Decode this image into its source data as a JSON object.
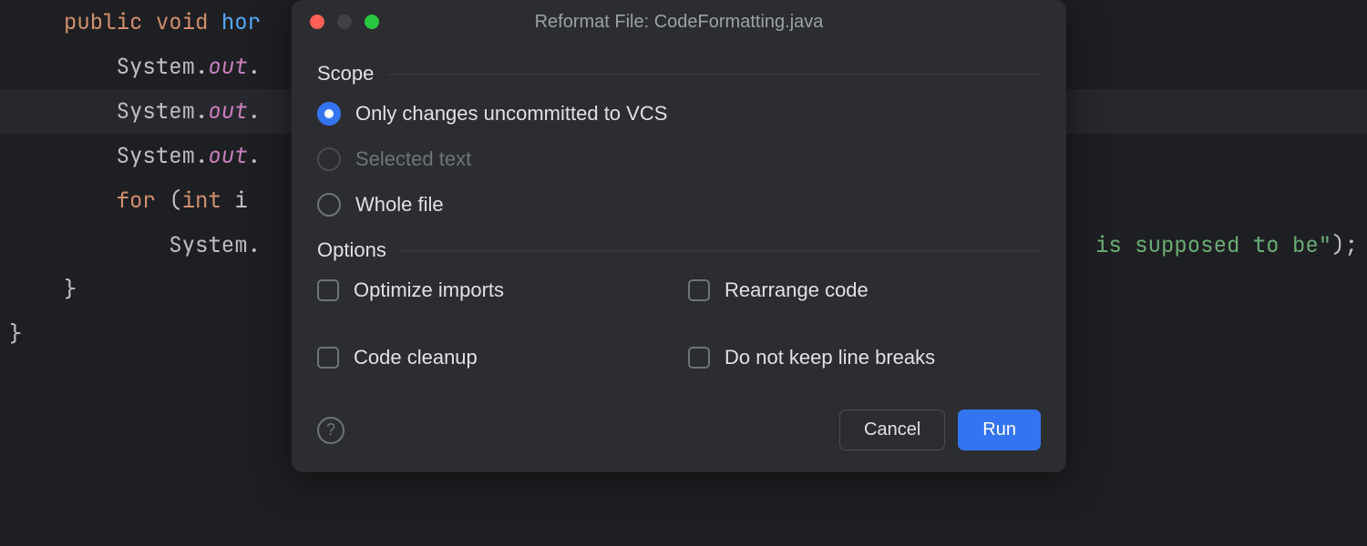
{
  "editor": {
    "lines": [
      {
        "hl": false,
        "segs": [
          {
            "t": "public ",
            "c": "kw-public"
          },
          {
            "t": "void ",
            "c": "kw-void"
          },
          {
            "t": "hor",
            "c": "method"
          }
        ]
      },
      {
        "hl": false,
        "indent": "    ",
        "segs": [
          {
            "t": "System.",
            "c": "ident"
          },
          {
            "t": "out",
            "c": "field-it"
          },
          {
            "t": ".",
            "c": "pn"
          }
        ]
      },
      {
        "hl": true,
        "indent": "    ",
        "segs": [
          {
            "t": "System.",
            "c": "ident"
          },
          {
            "t": "out",
            "c": "field-it"
          },
          {
            "t": ".",
            "c": "pn"
          }
        ]
      },
      {
        "hl": false,
        "indent": "    ",
        "segs": [
          {
            "t": "System.",
            "c": "ident"
          },
          {
            "t": "out",
            "c": "field-it"
          },
          {
            "t": ".",
            "c": "pn"
          }
        ]
      },
      {
        "hl": false,
        "indent": "    ",
        "segs": [
          {
            "t": "for ",
            "c": "kw-for"
          },
          {
            "t": "(",
            "c": "pn"
          },
          {
            "t": "int ",
            "c": "kw-int"
          },
          {
            "t": "i",
            "c": "ident"
          }
        ]
      },
      {
        "hl": false,
        "indent": "        ",
        "segs": [
          {
            "t": "System.",
            "c": "ident"
          }
        ],
        "tail": [
          {
            "t": "is supposed to be\"",
            "c": "str"
          },
          {
            "t": ");",
            "c": "pn"
          }
        ]
      },
      {
        "hl": false,
        "indent": "",
        "segs": [
          {
            "t": "}",
            "c": "pn"
          }
        ]
      },
      {
        "hl": false,
        "indent": "",
        "segs": []
      },
      {
        "hl": false,
        "noindent": true,
        "segs": [
          {
            "t": "}",
            "c": "pn"
          }
        ]
      }
    ]
  },
  "dialog": {
    "title": "Reformat File: CodeFormatting.java",
    "scope": {
      "heading": "Scope",
      "options": [
        {
          "label": "Only changes uncommitted to VCS",
          "selected": true,
          "disabled": false
        },
        {
          "label": "Selected text",
          "selected": false,
          "disabled": true
        },
        {
          "label": "Whole file",
          "selected": false,
          "disabled": false
        }
      ]
    },
    "options": {
      "heading": "Options",
      "items": [
        {
          "label": "Optimize imports",
          "checked": false
        },
        {
          "label": "Rearrange code",
          "checked": false
        },
        {
          "label": "Code cleanup",
          "checked": false
        },
        {
          "label": "Do not keep line breaks",
          "checked": false
        }
      ]
    },
    "buttons": {
      "cancel": "Cancel",
      "run": "Run"
    },
    "help": "?"
  }
}
